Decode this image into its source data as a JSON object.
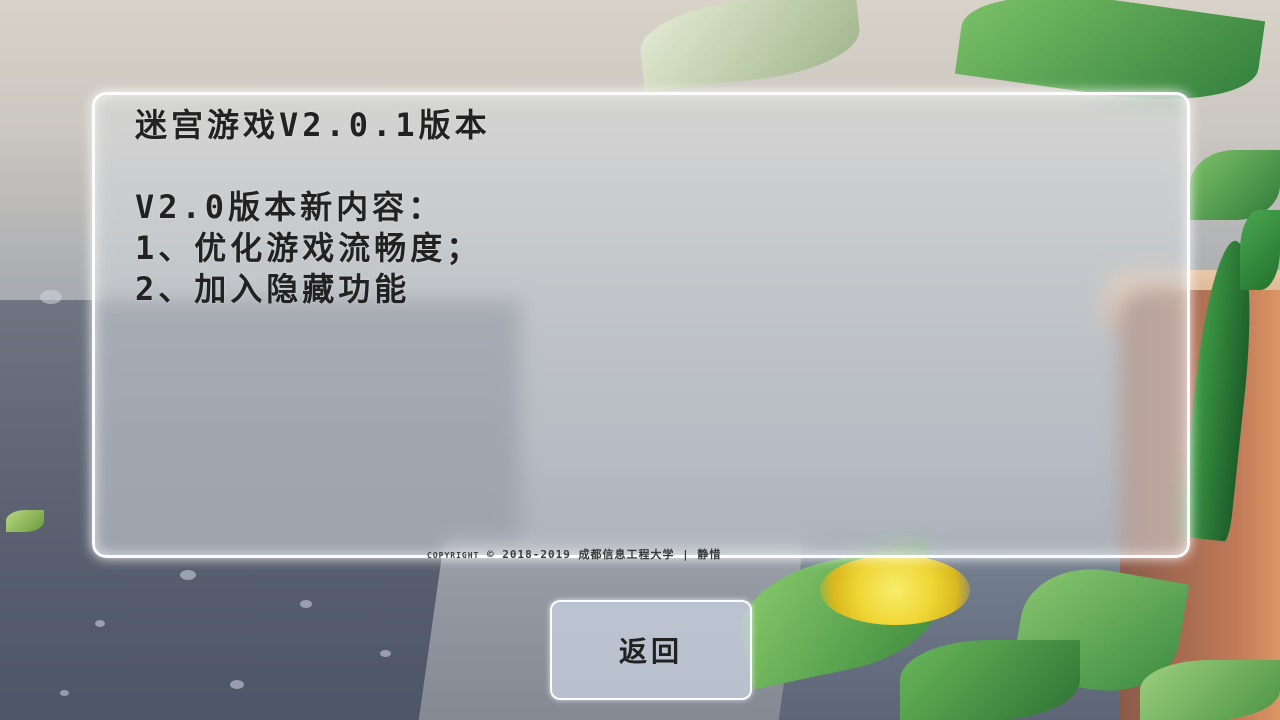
{
  "panel": {
    "title": "迷宫游戏V2.0.1版本",
    "blank": "",
    "heading": "V2.0版本新内容：",
    "item_1": "1、优化游戏流畅度；",
    "item_2": "2、加入隐藏功能"
  },
  "copyright": {
    "prefix": "COPYRIGHT",
    "text": "© 2018-2019 成都信息工程大学 | 静惜"
  },
  "back_button": {
    "label": "返回"
  },
  "colors": {
    "panel_border": "#ffffff",
    "text": "#222222",
    "flower_yellow": "#f0d635",
    "leaf_green": "#3f8f3a"
  }
}
